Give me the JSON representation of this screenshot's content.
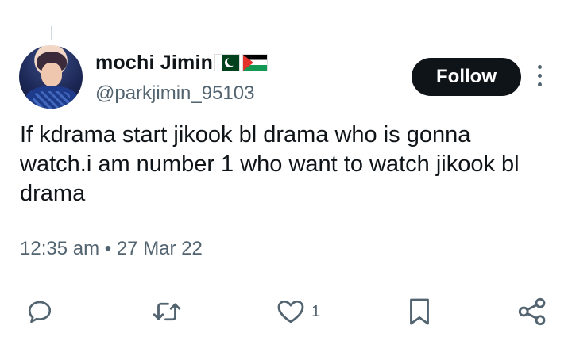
{
  "tweet": {
    "display_name": "mochi Jimin",
    "flags": [
      "pakistan-flag",
      "palestine-flag"
    ],
    "handle": "@parkjimin_95103",
    "text": "If kdrama start jikook bl drama who is gonna watch.i am number 1 who want to watch jikook bl drama",
    "time": "12:35 am",
    "separator": "•",
    "date": "27 Mar 22"
  },
  "buttons": {
    "follow_label": "Follow"
  },
  "actions": {
    "reply_icon": "reply-icon",
    "retweet_icon": "retweet-icon",
    "like_icon": "heart-icon",
    "like_count": "1",
    "bookmark_icon": "bookmark-icon",
    "share_icon": "share-icon"
  },
  "colors": {
    "text_primary": "#0f1419",
    "text_secondary": "#536471",
    "follow_bg": "#0f1419",
    "follow_text": "#ffffff"
  }
}
